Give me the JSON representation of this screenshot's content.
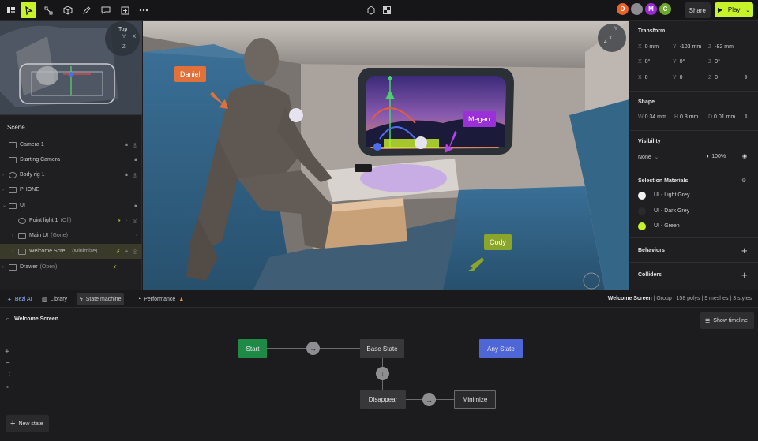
{
  "toolbar": {
    "tools": [
      "logo-icon",
      "select-icon",
      "transform-icon",
      "cube-icon",
      "pen-icon",
      "comment-icon",
      "add-icon",
      "more-icon"
    ],
    "collaborators": [
      {
        "initial": "D",
        "color": "#e8622a"
      },
      {
        "initial": "",
        "color": "#8c8c92"
      },
      {
        "initial": "M",
        "color": "#9a2ad6"
      },
      {
        "initial": "C",
        "color": "#6ea82a"
      }
    ],
    "share_label": "Share",
    "play_label": "Play"
  },
  "minimap": {
    "view_label": "Top",
    "axis_y": "Y",
    "axis_x": "X",
    "axis_z": "Z"
  },
  "scene": {
    "title": "Scene",
    "items": [
      {
        "label": "Camera 1",
        "status": ""
      },
      {
        "label": "Starting Camera",
        "status": ""
      },
      {
        "label": "Body rig 1",
        "status": ""
      },
      {
        "label": "PHONE",
        "status": ""
      },
      {
        "label": "UI",
        "status": ""
      },
      {
        "label": "Point light 1",
        "status": "(Off)"
      },
      {
        "label": "Main UI",
        "status": "(Gone)"
      },
      {
        "label": "Welcome Scre...",
        "status": "(Minimize)"
      },
      {
        "label": "Drawer",
        "status": "(Open)"
      }
    ]
  },
  "viewport": {
    "tags": [
      {
        "label": "Daniel",
        "color": "#e0713b"
      },
      {
        "label": "Megan",
        "color": "#9a30d8"
      },
      {
        "label": "Cody",
        "color": "#8aa52a"
      }
    ],
    "gizmo_axis_x": "X",
    "gizmo_axis_y": "Y",
    "gizmo_axis_z": "Z"
  },
  "properties": {
    "transform": {
      "title": "Transform",
      "position": [
        {
          "axis": "X",
          "value": "0 mm"
        },
        {
          "axis": "Y",
          "value": "-103 mm"
        },
        {
          "axis": "Z",
          "value": "-82 mm"
        }
      ],
      "rotation": [
        {
          "axis": "X",
          "value": "0°"
        },
        {
          "axis": "Y",
          "value": "0°"
        },
        {
          "axis": "Z",
          "value": "0°"
        }
      ],
      "scale": [
        {
          "axis": "X",
          "value": "0"
        },
        {
          "axis": "Y",
          "value": "0"
        },
        {
          "axis": "Z",
          "value": "0"
        }
      ]
    },
    "shape": {
      "title": "Shape",
      "dims": [
        {
          "axis": "W",
          "value": "0.34 mm"
        },
        {
          "axis": "H",
          "value": "0.3 mm"
        },
        {
          "axis": "D",
          "value": "0.01 mm"
        }
      ]
    },
    "visibility": {
      "title": "Visibility",
      "mode": "None",
      "opacity": "100%"
    },
    "materials": {
      "title": "Selection Materials",
      "items": [
        {
          "label": "UI - Light Grey",
          "color": "#f2f2f2"
        },
        {
          "label": "UI - Dark Grey",
          "color": "#2a2a2c"
        },
        {
          "label": "UI - Green",
          "color": "#c6f22a"
        }
      ]
    },
    "behaviors_title": "Behaviors",
    "colliders_title": "Colliders"
  },
  "bottom_tabs": {
    "tabs": [
      {
        "label": "Bezi AI"
      },
      {
        "label": "Library"
      },
      {
        "label": "State machine"
      },
      {
        "label": "Performance"
      }
    ],
    "selection_name": "Welcome Screen",
    "selection_info": "| Group | 158 polys | 9 meshes | 3 styles"
  },
  "state_machine": {
    "title": "Welcome Screen",
    "show_timeline": "Show timeline",
    "new_state": "New state",
    "nodes": {
      "start": "Start",
      "base": "Base State",
      "any": "Any State",
      "disappear": "Disappear",
      "minimize": "Minimize"
    },
    "colors": {
      "start": "#1e8a46",
      "any": "#4f67d6",
      "node": "#38383b"
    }
  }
}
